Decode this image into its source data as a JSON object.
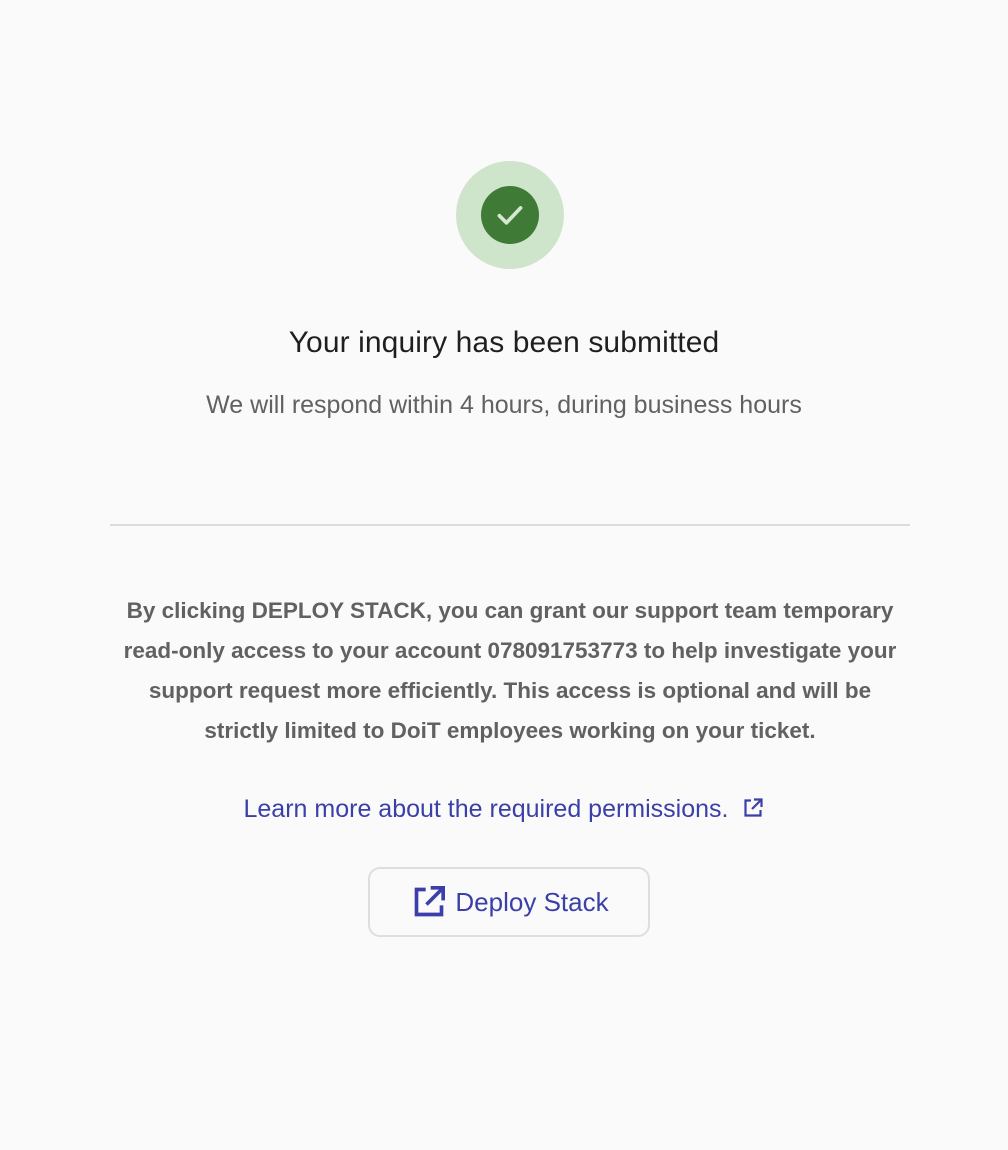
{
  "success": {
    "icon": "check-circle-icon",
    "badge_bg": "#cfe5cb",
    "icon_bg": "#3f7a37"
  },
  "heading": {
    "title": "Your inquiry has been submitted",
    "subtitle": "We will respond within 4 hours, during business hours"
  },
  "access": {
    "description": "By clicking DEPLOY STACK, you can grant our support team temporary read-only access to your account 078091753773 to help investigate your support request more efficiently. This access is optional and will be strictly limited to DoiT employees working on your ticket.",
    "learn_more": "Learn more about the required permissions.",
    "learn_more_icon": "external-link-icon"
  },
  "actions": {
    "deploy_label": "Deploy Stack",
    "deploy_icon": "open-in-new-icon",
    "accent_color": "#3b3fa8"
  }
}
